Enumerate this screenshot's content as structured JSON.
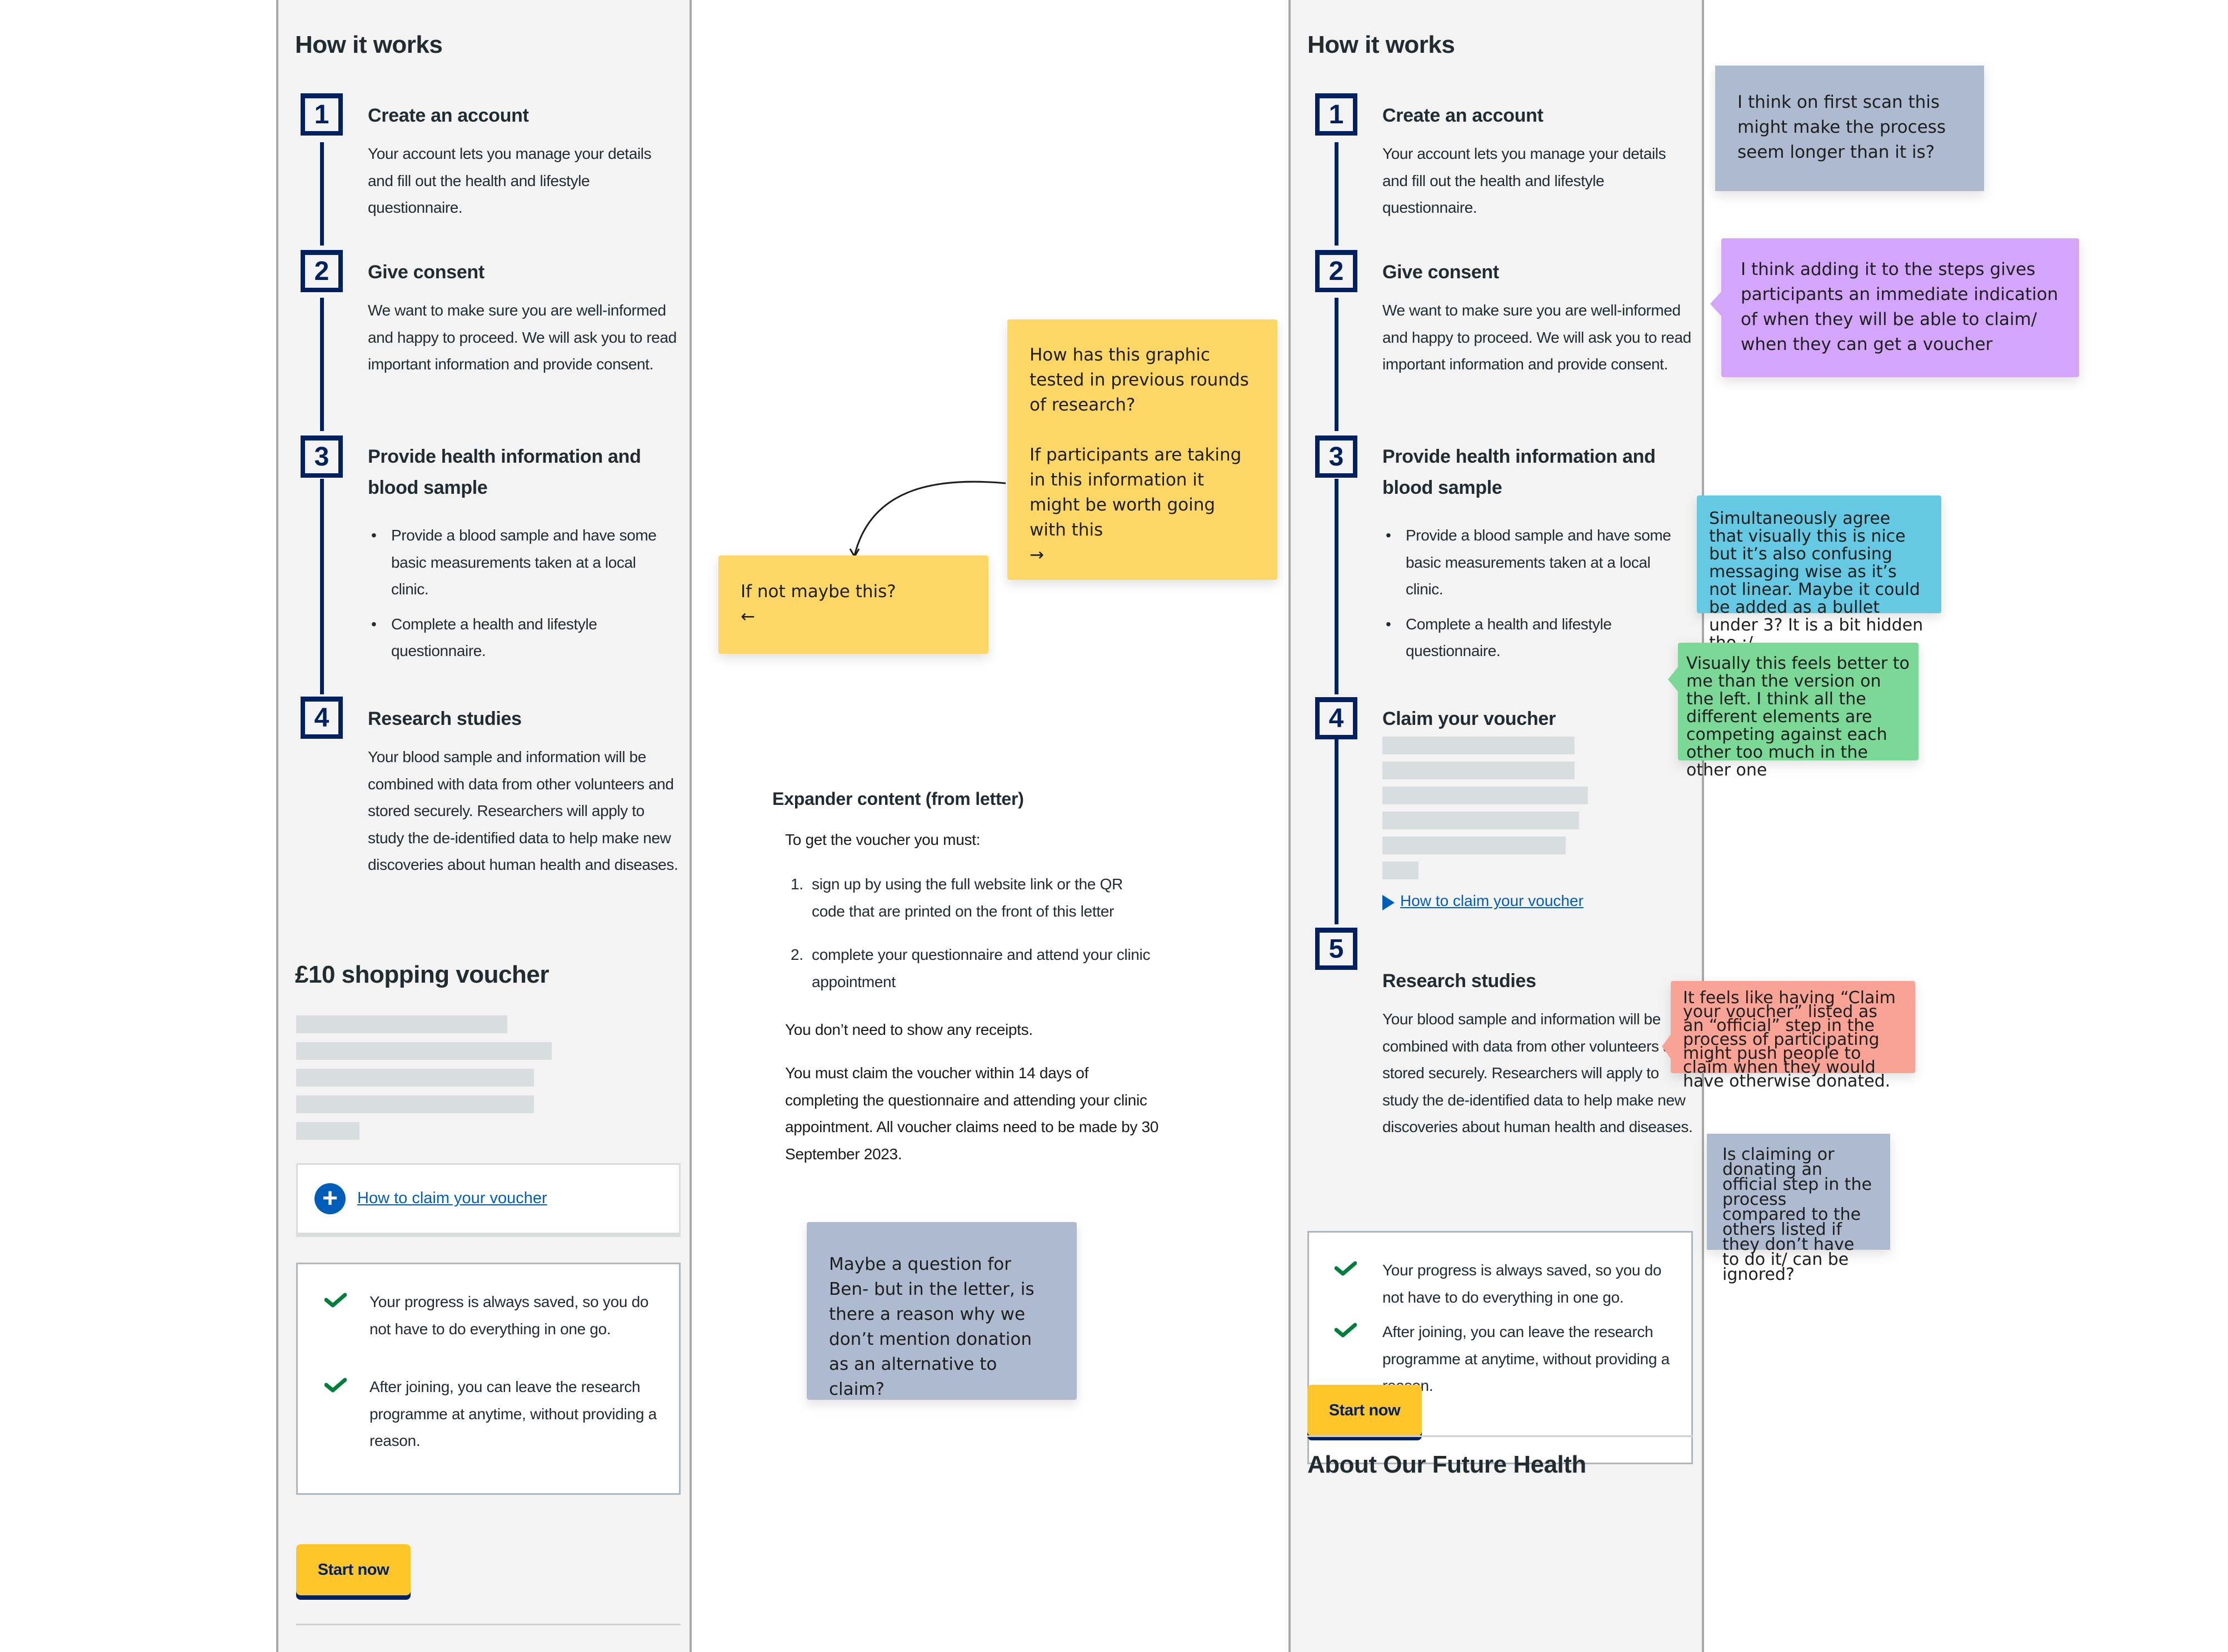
{
  "left_panel": {
    "heading": "How it works",
    "steps": [
      {
        "number": "1",
        "title": "Create an account",
        "body": "Your account lets you manage your details and fill out the health and lifestyle questionnaire."
      },
      {
        "number": "2",
        "title": "Give consent",
        "body": "We want to make sure you are well-informed and happy to proceed. We will ask you to read important information and provide consent."
      },
      {
        "number": "3",
        "title": "Provide health information and blood sample",
        "bullets": [
          "Provide a blood sample and have some basic measurements taken at a local clinic.",
          "Complete a health and lifestyle questionnaire."
        ]
      },
      {
        "number": "4",
        "title": "Research studies",
        "body": "Your blood sample and information will be combined with data from other volunteers and stored securely. Researchers will apply to study the de-identified data to help make new discoveries about human health and diseases."
      }
    ],
    "voucher_heading": "£10 shopping voucher",
    "expander_link": "How to claim your voucher",
    "checklist": [
      "Your progress is always saved, so you do not have to do everything in one go.",
      "After joining, you can leave the research programme at anytime, without providing a reason."
    ],
    "start_button": "Start now"
  },
  "right_panel": {
    "heading": "How it works",
    "steps": [
      {
        "number": "1",
        "title": "Create an account",
        "body": "Your account lets you manage your details and fill out the health and lifestyle questionnaire."
      },
      {
        "number": "2",
        "title": "Give consent",
        "body": "We want to make sure you are well-informed and happy to proceed. We will ask you to read important information and provide consent."
      },
      {
        "number": "3",
        "title": "Provide health information and blood sample",
        "bullets": [
          "Provide a blood sample and have some basic measurements taken at a local clinic.",
          "Complete a health and lifestyle questionnaire."
        ]
      },
      {
        "number": "4",
        "title": "Claim your voucher",
        "details_link": "How to claim your voucher"
      },
      {
        "number": "5",
        "title": "Research studies",
        "body": "Your blood sample and information will be combined with data from other volunteers and stored securely. Researchers will apply to study the de-identified data to help make new discoveries about human health and diseases."
      }
    ],
    "checklist": [
      "Your progress is always saved, so you do not have to do everything in one go.",
      "After joining, you can leave the research programme at anytime, without providing a reason."
    ],
    "start_button": "Start now",
    "about_heading": "About Our Future Health"
  },
  "letter": {
    "title": "Expander content (from letter)",
    "intro": "To get the voucher you must:",
    "items": [
      {
        "num": "1.",
        "text": "sign up by using the full website link or the QR code that are printed on the front of this letter"
      },
      {
        "num": "2.",
        "text": "complete your questionnaire and attend your clinic appointment"
      }
    ],
    "receipts": "You don’t need to show any receipts.",
    "deadline": "You must claim the voucher within 14 days of completing the questionnaire and attending your clinic appointment. All voucher claims need to be made by 30 September 2023."
  },
  "stickies": {
    "graphic_question": "How has this graphic tested in previous rounds of research?\n\nIf participants are taking in this information it might be worth going with this\n→",
    "if_not": "If not maybe this?\n←",
    "ben_question": "Maybe a question for Ben- but in the letter, is there a reason why we don’t mention donation as an alternative to claim?",
    "first_scan": "I think on first scan this might make the process seem longer than it is?",
    "adding_steps": "I think adding it to the steps gives participants an immediate indication of when they will be able to claim/ when they can get a voucher",
    "simultaneously": "Simultaneously agree that visually this is nice but it’s also confusing messaging wise as it’s not linear. Maybe it could be added as a bullet under 3? It is a bit hidden tho :/",
    "visually_better": "Visually this feels better to me than the version on the left. I think all the different elements are competing against each other too much in the other one",
    "official_step": "It feels like having “Claim your voucher” listed as an “official” step in the process of participating might push people to claim when they would have otherwise donated.",
    "claiming_donating": "Is claiming or donating an official step in the process compared to the others listed if they don’t have to do it/ can be ignored?"
  },
  "colors": {
    "navy": "#002060",
    "link_blue": "#005eb8",
    "button_yellow": "#ffc62b",
    "check_green": "#007f3b",
    "panel_bg": "#f3f3f3",
    "sticky_yellow": "#fdd766",
    "sticky_grey": "#aebad0",
    "sticky_purple": "#d3a6fb",
    "sticky_blue": "#66c9e3",
    "sticky_green": "#7bd897",
    "sticky_red": "#f9a397"
  }
}
